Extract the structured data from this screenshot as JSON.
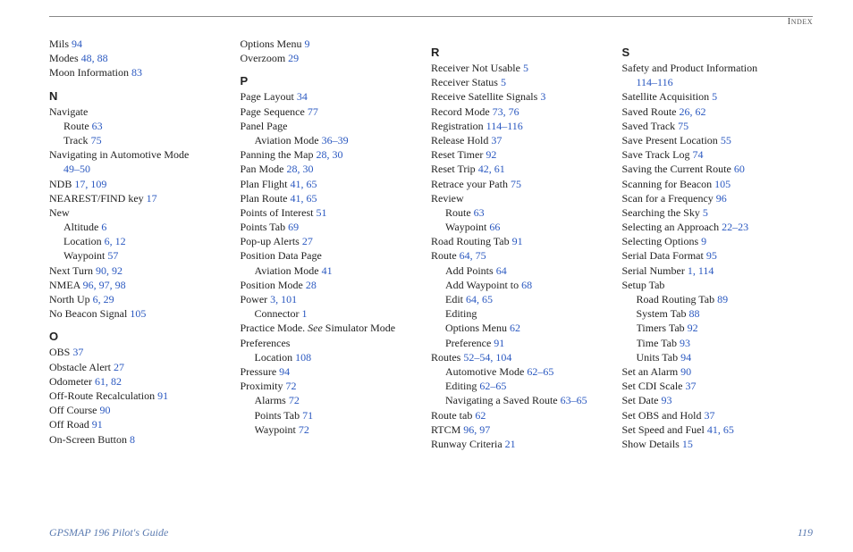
{
  "header": "Index",
  "footer_left": "GPSMAP 196 Pilot's Guide",
  "footer_right": "119",
  "columns": [
    [
      {
        "t": "entry",
        "lvl": 1,
        "label": "Mils",
        "pages": "94"
      },
      {
        "t": "entry",
        "lvl": 1,
        "label": "Modes",
        "pages": "48, 88"
      },
      {
        "t": "entry",
        "lvl": 1,
        "label": "Moon Information",
        "pages": "83"
      },
      {
        "t": "letter",
        "label": "N"
      },
      {
        "t": "entry",
        "lvl": 1,
        "label": "Navigate",
        "pages": ""
      },
      {
        "t": "entry",
        "lvl": 2,
        "label": "Route",
        "pages": "63"
      },
      {
        "t": "entry",
        "lvl": 2,
        "label": "Track",
        "pages": "75"
      },
      {
        "t": "entry",
        "lvl": 1,
        "label": "Navigating in Automotive Mode",
        "pages": ""
      },
      {
        "t": "entry",
        "lvl": 2,
        "label": "",
        "pages": "49–50"
      },
      {
        "t": "entry",
        "lvl": 1,
        "label": "NDB",
        "pages": "17, 109"
      },
      {
        "t": "entry",
        "lvl": 1,
        "label": "NEAREST/FIND key",
        "pages": "17"
      },
      {
        "t": "entry",
        "lvl": 1,
        "label": "New",
        "pages": ""
      },
      {
        "t": "entry",
        "lvl": 2,
        "label": "Altitude",
        "pages": "6"
      },
      {
        "t": "entry",
        "lvl": 2,
        "label": "Location",
        "pages": "6, 12"
      },
      {
        "t": "entry",
        "lvl": 2,
        "label": "Waypoint",
        "pages": "57"
      },
      {
        "t": "entry",
        "lvl": 1,
        "label": "Next Turn",
        "pages": "90, 92"
      },
      {
        "t": "entry",
        "lvl": 1,
        "label": "NMEA",
        "pages": "96, 97, 98"
      },
      {
        "t": "entry",
        "lvl": 1,
        "label": "North Up",
        "pages": "6, 29"
      },
      {
        "t": "entry",
        "lvl": 1,
        "label": "No Beacon Signal",
        "pages": "105"
      },
      {
        "t": "letter",
        "label": "O"
      },
      {
        "t": "entry",
        "lvl": 1,
        "label": "OBS",
        "pages": "37"
      },
      {
        "t": "entry",
        "lvl": 1,
        "label": "Obstacle Alert",
        "pages": "27"
      },
      {
        "t": "entry",
        "lvl": 1,
        "label": "Odometer",
        "pages": "61, 82"
      },
      {
        "t": "entry",
        "lvl": 1,
        "label": "Off-Route Recalculation",
        "pages": "91"
      },
      {
        "t": "entry",
        "lvl": 1,
        "label": "Off Course",
        "pages": "90"
      },
      {
        "t": "entry",
        "lvl": 1,
        "label": "Off Road",
        "pages": "91"
      },
      {
        "t": "entry",
        "lvl": 1,
        "label": "On-Screen Button",
        "pages": "8"
      }
    ],
    [
      {
        "t": "entry",
        "lvl": 1,
        "label": "Options Menu",
        "pages": "9"
      },
      {
        "t": "entry",
        "lvl": 1,
        "label": "Overzoom",
        "pages": "29"
      },
      {
        "t": "letter",
        "label": "P"
      },
      {
        "t": "entry",
        "lvl": 1,
        "label": "Page Layout",
        "pages": "34"
      },
      {
        "t": "entry",
        "lvl": 1,
        "label": "Page Sequence",
        "pages": "77"
      },
      {
        "t": "entry",
        "lvl": 1,
        "label": "Panel Page",
        "pages": ""
      },
      {
        "t": "entry",
        "lvl": 2,
        "label": "Aviation Mode",
        "pages": "36–39"
      },
      {
        "t": "entry",
        "lvl": 1,
        "label": "Panning the Map",
        "pages": "28, 30"
      },
      {
        "t": "entry",
        "lvl": 1,
        "label": "Pan Mode",
        "pages": "28, 30"
      },
      {
        "t": "entry",
        "lvl": 1,
        "label": "Plan Flight",
        "pages": "41, 65"
      },
      {
        "t": "entry",
        "lvl": 1,
        "label": "Plan Route",
        "pages": "41, 65"
      },
      {
        "t": "entry",
        "lvl": 1,
        "label": "Points of Interest",
        "pages": "51"
      },
      {
        "t": "entry",
        "lvl": 1,
        "label": "Points Tab",
        "pages": "69"
      },
      {
        "t": "entry",
        "lvl": 1,
        "label": "Pop-up Alerts",
        "pages": "27"
      },
      {
        "t": "entry",
        "lvl": 1,
        "label": "Position Data Page",
        "pages": ""
      },
      {
        "t": "entry",
        "lvl": 2,
        "label": "Aviation Mode",
        "pages": "41"
      },
      {
        "t": "entry",
        "lvl": 1,
        "label": "Position Mode",
        "pages": "28"
      },
      {
        "t": "entry",
        "lvl": 1,
        "label": "Power",
        "pages": "3, 101"
      },
      {
        "t": "entry",
        "lvl": 2,
        "label": "Connector",
        "pages": "1"
      },
      {
        "t": "see",
        "lvl": 1,
        "label": "Practice Mode.",
        "see": "See",
        "target": "Simulator Mode"
      },
      {
        "t": "entry",
        "lvl": 1,
        "label": "Preferences",
        "pages": ""
      },
      {
        "t": "entry",
        "lvl": 2,
        "label": "Location",
        "pages": "108"
      },
      {
        "t": "entry",
        "lvl": 1,
        "label": "Pressure",
        "pages": "94"
      },
      {
        "t": "entry",
        "lvl": 1,
        "label": "Proximity",
        "pages": "72"
      },
      {
        "t": "entry",
        "lvl": 2,
        "label": "Alarms",
        "pages": "72"
      },
      {
        "t": "entry",
        "lvl": 2,
        "label": "Points Tab",
        "pages": "71"
      },
      {
        "t": "entry",
        "lvl": 2,
        "label": "Waypoint",
        "pages": "72"
      }
    ],
    [
      {
        "t": "letter",
        "label": "R"
      },
      {
        "t": "entry",
        "lvl": 1,
        "label": "Receiver Not Usable",
        "pages": "5"
      },
      {
        "t": "entry",
        "lvl": 1,
        "label": "Receiver Status",
        "pages": "5"
      },
      {
        "t": "entry",
        "lvl": 1,
        "label": "Receive Satellite Signals",
        "pages": "3"
      },
      {
        "t": "entry",
        "lvl": 1,
        "label": "Record Mode",
        "pages": "73, 76"
      },
      {
        "t": "entry",
        "lvl": 1,
        "label": "Registration",
        "pages": "114–116"
      },
      {
        "t": "entry",
        "lvl": 1,
        "label": "Release Hold",
        "pages": "37"
      },
      {
        "t": "entry",
        "lvl": 1,
        "label": "Reset Timer",
        "pages": "92"
      },
      {
        "t": "entry",
        "lvl": 1,
        "label": "Reset Trip",
        "pages": "42, 61"
      },
      {
        "t": "entry",
        "lvl": 1,
        "label": "Retrace your Path",
        "pages": "75"
      },
      {
        "t": "entry",
        "lvl": 1,
        "label": "Review",
        "pages": ""
      },
      {
        "t": "entry",
        "lvl": 2,
        "label": "Route",
        "pages": "63"
      },
      {
        "t": "entry",
        "lvl": 2,
        "label": "Waypoint",
        "pages": "66"
      },
      {
        "t": "entry",
        "lvl": 1,
        "label": "Road Routing Tab",
        "pages": "91"
      },
      {
        "t": "entry",
        "lvl": 1,
        "label": "Route",
        "pages": "64, 75"
      },
      {
        "t": "entry",
        "lvl": 2,
        "label": "Add Points",
        "pages": "64"
      },
      {
        "t": "entry",
        "lvl": 2,
        "label": "Add Waypoint to",
        "pages": "68"
      },
      {
        "t": "entry",
        "lvl": 2,
        "label": "Edit",
        "pages": "64, 65"
      },
      {
        "t": "entry",
        "lvl": 2,
        "label": "Editing",
        "pages": ""
      },
      {
        "t": "entry",
        "lvl": 2,
        "label": "Options Menu",
        "pages": "62"
      },
      {
        "t": "entry",
        "lvl": 2,
        "label": "Preference",
        "pages": "91"
      },
      {
        "t": "entry",
        "lvl": 1,
        "label": "Routes",
        "pages": "52–54, 104"
      },
      {
        "t": "entry",
        "lvl": 2,
        "label": "Automotive Mode",
        "pages": "62–65"
      },
      {
        "t": "entry",
        "lvl": 2,
        "label": "Editing",
        "pages": "62–65"
      },
      {
        "t": "entry",
        "lvl": 2,
        "label": "Navigating a Saved Route",
        "pages": "63–65"
      },
      {
        "t": "entry",
        "lvl": 1,
        "label": "Route tab",
        "pages": "62"
      },
      {
        "t": "entry",
        "lvl": 1,
        "label": "RTCM",
        "pages": "96, 97"
      },
      {
        "t": "entry",
        "lvl": 1,
        "label": "Runway Criteria",
        "pages": "21"
      }
    ],
    [
      {
        "t": "letter",
        "label": "S"
      },
      {
        "t": "entry",
        "lvl": 1,
        "label": "Safety and Product Information",
        "pages": ""
      },
      {
        "t": "entry",
        "lvl": 2,
        "label": "",
        "pages": "114–116"
      },
      {
        "t": "entry",
        "lvl": 1,
        "label": "Satellite Acquisition",
        "pages": "5"
      },
      {
        "t": "entry",
        "lvl": 1,
        "label": "Saved Route",
        "pages": "26, 62"
      },
      {
        "t": "entry",
        "lvl": 1,
        "label": "Saved Track",
        "pages": "75"
      },
      {
        "t": "entry",
        "lvl": 1,
        "label": "Save Present Location",
        "pages": "55"
      },
      {
        "t": "entry",
        "lvl": 1,
        "label": "Save Track Log",
        "pages": "74"
      },
      {
        "t": "entry",
        "lvl": 1,
        "label": "Saving the Current Route",
        "pages": "60"
      },
      {
        "t": "entry",
        "lvl": 1,
        "label": "Scanning for Beacon",
        "pages": "105"
      },
      {
        "t": "entry",
        "lvl": 1,
        "label": "Scan for a Frequency",
        "pages": "96"
      },
      {
        "t": "entry",
        "lvl": 1,
        "label": "Searching the Sky",
        "pages": "5"
      },
      {
        "t": "entry",
        "lvl": 1,
        "label": "Selecting an Approach",
        "pages": "22–23"
      },
      {
        "t": "entry",
        "lvl": 1,
        "label": "Selecting Options",
        "pages": "9"
      },
      {
        "t": "entry",
        "lvl": 1,
        "label": "Serial Data Format",
        "pages": "95"
      },
      {
        "t": "entry",
        "lvl": 1,
        "label": "Serial Number",
        "pages": "1, 114"
      },
      {
        "t": "entry",
        "lvl": 1,
        "label": "Setup Tab",
        "pages": ""
      },
      {
        "t": "entry",
        "lvl": 2,
        "label": "Road Routing Tab",
        "pages": "89"
      },
      {
        "t": "entry",
        "lvl": 2,
        "label": "System Tab",
        "pages": "88"
      },
      {
        "t": "entry",
        "lvl": 2,
        "label": "Timers Tab",
        "pages": "92"
      },
      {
        "t": "entry",
        "lvl": 2,
        "label": "Time Tab",
        "pages": "93"
      },
      {
        "t": "entry",
        "lvl": 2,
        "label": "Units Tab",
        "pages": "94"
      },
      {
        "t": "entry",
        "lvl": 1,
        "label": "Set an Alarm",
        "pages": "90"
      },
      {
        "t": "entry",
        "lvl": 1,
        "label": "Set CDI Scale",
        "pages": "37"
      },
      {
        "t": "entry",
        "lvl": 1,
        "label": "Set Date",
        "pages": "93"
      },
      {
        "t": "entry",
        "lvl": 1,
        "label": "Set OBS and Hold",
        "pages": "37"
      },
      {
        "t": "entry",
        "lvl": 1,
        "label": "Set Speed and Fuel",
        "pages": "41, 65"
      },
      {
        "t": "entry",
        "lvl": 1,
        "label": "Show Details",
        "pages": "15"
      }
    ]
  ]
}
